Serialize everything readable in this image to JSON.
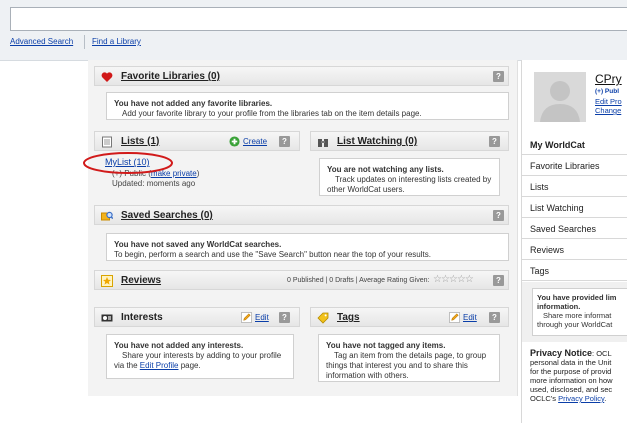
{
  "search": {
    "placeholder": ""
  },
  "links": {
    "advanced_search": "Advanced Search",
    "find_library": "Find a Library"
  },
  "favorite_libraries": {
    "title": "Favorite Libraries (0)",
    "line1": "You have not added any favorite libraries.",
    "line2": "Add your favorite library to your profile from the libraries tab on the item details page."
  },
  "lists": {
    "title": "Lists (1)",
    "create": "Create",
    "item_name": "MyList (10)",
    "public_label": "(+) Public (",
    "make_private": "make private",
    "close_paren": ")",
    "updated": "Updated: moments ago"
  },
  "list_watching": {
    "title": "List Watching (0)",
    "line1": "You are not watching any lists.",
    "line2": "Track updates on interesting lists created by other WorldCat users."
  },
  "saved_searches": {
    "title": "Saved Searches (0)",
    "line1": "You have not saved any WorldCat searches.",
    "line2": "To begin, perform a search and use the \"Save Search\" button near the top of your results."
  },
  "reviews": {
    "title": "Reviews",
    "stats": "0 Published  |  0 Drafts  |  Average Rating Given:",
    "stars": "☆☆☆☆☆"
  },
  "interests": {
    "title": "Interests",
    "edit": "Edit",
    "line1": "You have not added any interests.",
    "line2a": "Share your interests by adding to your profile via the ",
    "edit_profile": "Edit Profile",
    "line2b": " page."
  },
  "tags": {
    "title": "Tags",
    "edit": "Edit",
    "line1": "You have not tagged any items.",
    "line2": "Tag an item from the details page, to group things that interest you and to share this information with others."
  },
  "profile": {
    "name": "CPry",
    "public": "(+) Publ",
    "edit_profile": "Edit Pro",
    "change": "Change"
  },
  "right_nav": [
    "My WorldCat",
    "Favorite Libraries",
    "Lists",
    "List Watching",
    "Saved Searches",
    "Reviews",
    "Tags"
  ],
  "tags_info": {
    "line1": "You have provided lim",
    "line2": "information.",
    "line3": "Share more informat",
    "line4": "through your WorldCat"
  },
  "privacy": {
    "heading": "Privacy Notice",
    "rest": ": OCL",
    "l1": "personal data in the Unit",
    "l2": "for the purpose of provid",
    "l3": "more information on how",
    "l4": "used, disclosed, and sec",
    "l5a": "OCLC's ",
    "l5link": "Privacy Policy",
    "l5b": "."
  },
  "annotation_color": "#d11a1a"
}
